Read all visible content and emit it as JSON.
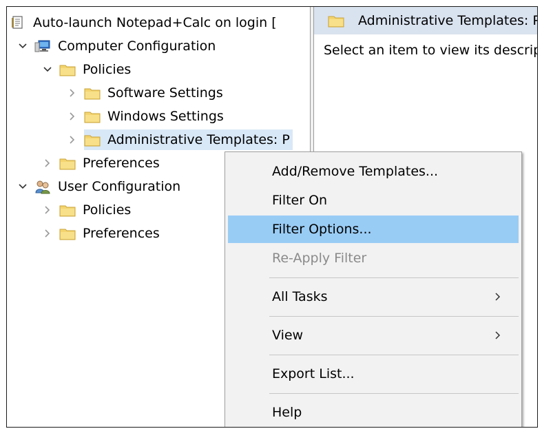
{
  "tree": {
    "root": "Auto-launch Notepad+Calc on login [",
    "computer_configuration": "Computer Configuration",
    "policies": "Policies",
    "software_settings": "Software Settings",
    "windows_settings": "Windows Settings",
    "administrative_templates": "Administrative Templates: P",
    "preferences": "Preferences",
    "user_configuration": "User Configuration",
    "user_policies": "Policies",
    "user_preferences": "Preferences"
  },
  "right_pane": {
    "header": "Administrative Templates: P",
    "description": "Select an item to view its description."
  },
  "context_menu": {
    "add_remove_templates": "Add/Remove Templates...",
    "filter_on": "Filter On",
    "filter_options": "Filter Options...",
    "reapply_filter": "Re-Apply Filter",
    "all_tasks": "All Tasks",
    "view": "View",
    "export_list": "Export List...",
    "help": "Help"
  },
  "colors": {
    "selection": "#d9e8f7",
    "menu_highlight": "#99ccf5",
    "folder": "#f3d46f",
    "header_bg": "#d9e2ef"
  }
}
